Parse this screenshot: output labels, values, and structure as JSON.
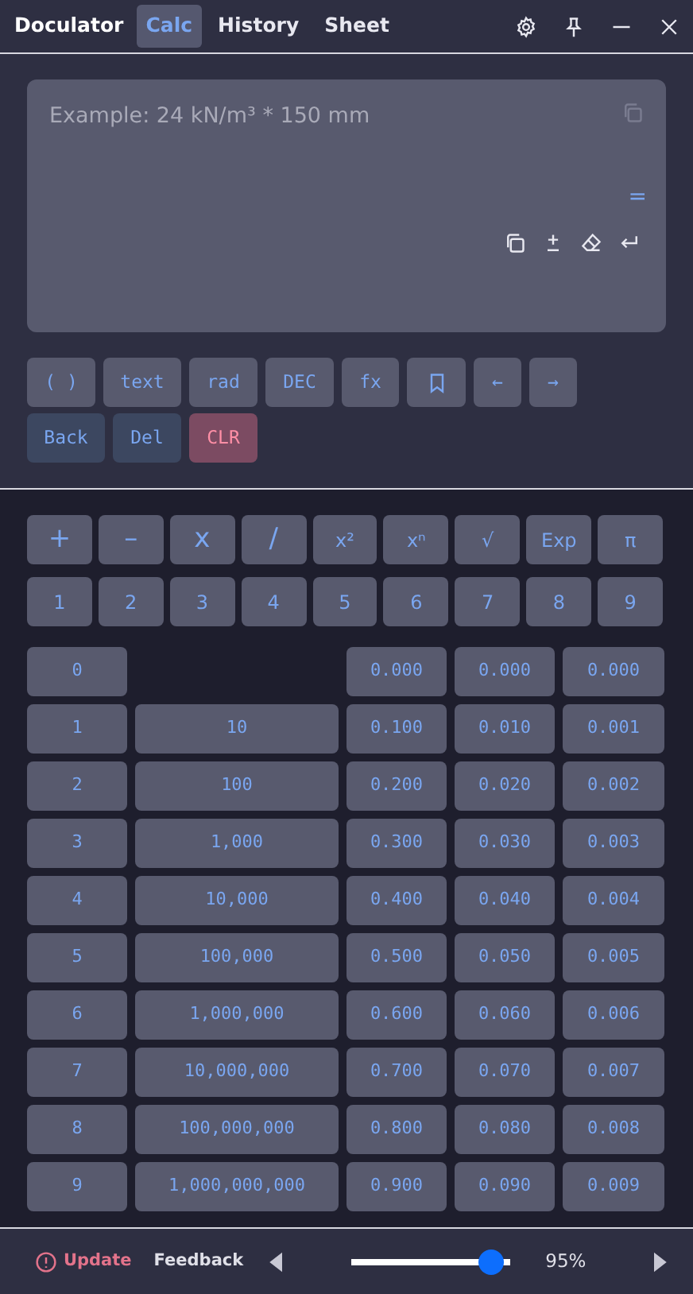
{
  "window": {
    "title": "Doculator"
  },
  "tabs": [
    {
      "label": "Calc",
      "selected": true
    },
    {
      "label": "History",
      "selected": false
    },
    {
      "label": "Sheet",
      "selected": false
    }
  ],
  "input": {
    "placeholder": "Example: 24 kN/m³ * 150 mm",
    "result": "="
  },
  "function_keys": [
    {
      "kind": "text",
      "label": "( )"
    },
    {
      "kind": "text",
      "label": "text"
    },
    {
      "kind": "text",
      "label": "rad"
    },
    {
      "kind": "text",
      "label": "DEC"
    },
    {
      "kind": "text",
      "label": "fx"
    },
    {
      "kind": "bookmark"
    },
    {
      "kind": "text",
      "label": "←"
    },
    {
      "kind": "text",
      "label": "→"
    }
  ],
  "edit_keys": [
    {
      "kind": "edit",
      "label": "Back"
    },
    {
      "kind": "edit",
      "label": "Del"
    },
    {
      "kind": "danger",
      "label": "CLR"
    }
  ],
  "operator_keys": [
    "+",
    "–",
    "x",
    "/",
    "x²",
    "xⁿ",
    "√",
    "Exp",
    "π"
  ],
  "digit_keys": [
    "1",
    "2",
    "3",
    "4",
    "5",
    "6",
    "7",
    "8",
    "9"
  ],
  "table": {
    "rows": [
      {
        "index": "0",
        "decimals": [
          "0.000",
          "0.000",
          "0.000"
        ]
      },
      {
        "index": "1",
        "power": "10",
        "decimals": [
          "0.100",
          "0.010",
          "0.001"
        ]
      },
      {
        "index": "2",
        "power": "100",
        "decimals": [
          "0.200",
          "0.020",
          "0.002"
        ]
      },
      {
        "index": "3",
        "power": "1,000",
        "decimals": [
          "0.300",
          "0.030",
          "0.003"
        ]
      },
      {
        "index": "4",
        "power": "10,000",
        "decimals": [
          "0.400",
          "0.040",
          "0.004"
        ]
      },
      {
        "index": "5",
        "power": "100,000",
        "decimals": [
          "0.500",
          "0.050",
          "0.005"
        ]
      },
      {
        "index": "6",
        "power": "1,000,000",
        "decimals": [
          "0.600",
          "0.060",
          "0.006"
        ]
      },
      {
        "index": "7",
        "power": "10,000,000",
        "decimals": [
          "0.700",
          "0.070",
          "0.007"
        ]
      },
      {
        "index": "8",
        "power": "100,000,000",
        "decimals": [
          "0.800",
          "0.080",
          "0.008"
        ]
      },
      {
        "index": "9",
        "power": "1,000,000,000",
        "decimals": [
          "0.900",
          "0.090",
          "0.009"
        ]
      }
    ]
  },
  "footer": {
    "update": "Update",
    "feedback": "Feedback",
    "zoom": {
      "level": 0.88,
      "reading": "95%"
    }
  }
}
